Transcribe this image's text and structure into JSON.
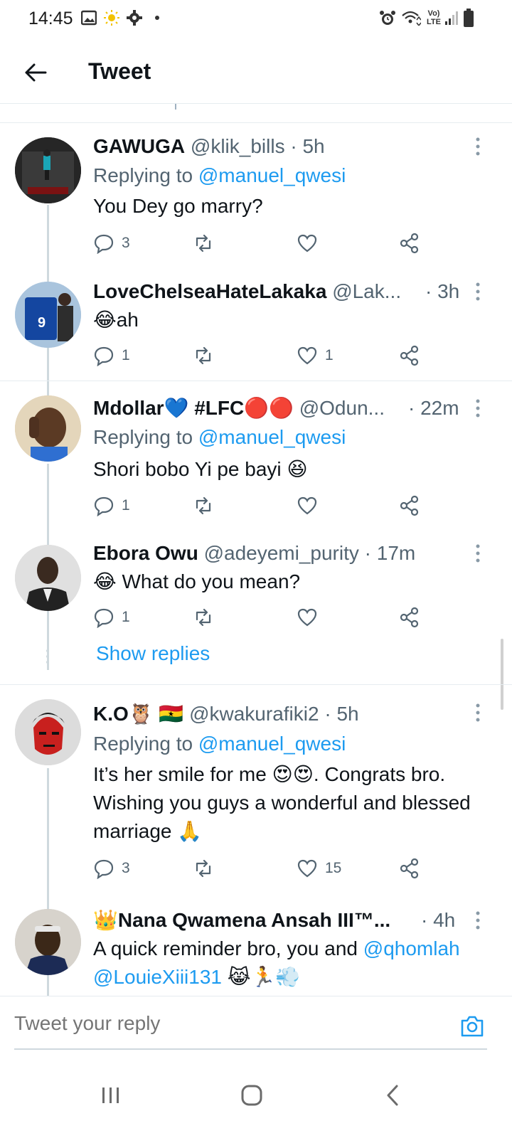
{
  "status_bar": {
    "time": "14:45",
    "network": "Vo) LTE"
  },
  "header": {
    "title": "Tweet"
  },
  "tweets": [
    {
      "name": "GAWUGA",
      "handle": "@klik_bills",
      "time": "· 5h",
      "replying_label": "Replying to",
      "replying_to": "@manuel_qwesi",
      "text": "You Dey go marry?",
      "replies": "3",
      "retweets": "",
      "likes": ""
    },
    {
      "name": "LoveChelseaHateLakaka",
      "handle": "@Lak...",
      "time": "· 3h",
      "text_emoji": "😂",
      "text": "ah",
      "replies": "1",
      "retweets": "",
      "likes": "1"
    },
    {
      "name": "Mdollar💙 #LFC🔴🔴",
      "handle": "@Odun...",
      "time": "· 22m",
      "replying_label": "Replying to",
      "replying_to": "@manuel_qwesi",
      "text": "Shori bobo Yi pe bayi 😆",
      "replies": "1",
      "retweets": "",
      "likes": ""
    },
    {
      "name": "Ebora Owu",
      "handle": "@adeyemi_purity",
      "time": "· 17m",
      "text": "😂 What do you mean?",
      "replies": "1",
      "retweets": "",
      "likes": ""
    },
    {
      "name": "K.O🦉 🇬🇭",
      "handle": "@kwakurafiki2",
      "time": "· 5h",
      "replying_label": "Replying to",
      "replying_to": "@manuel_qwesi",
      "text": "It’s her smile for me 😍😍. Congrats bro. Wishing you guys a wonderful and blessed marriage 🙏",
      "replies": "3",
      "retweets": "",
      "likes": "15"
    },
    {
      "name": "👑Nana Qwamena Ansah III™...",
      "handle": "",
      "time": "· 4h",
      "text_start": "A quick reminder bro, you and ",
      "mention1": "@qhomlah",
      "mention2": "@LouieXiii131",
      "text_end": " 😹🏃💨"
    }
  ],
  "show_replies": "Show replies",
  "reply_bar": {
    "placeholder": "Tweet your reply"
  },
  "colors": {
    "accent": "#1d9bf0",
    "secondary_text": "#536471",
    "divider": "#e6ecf0"
  }
}
